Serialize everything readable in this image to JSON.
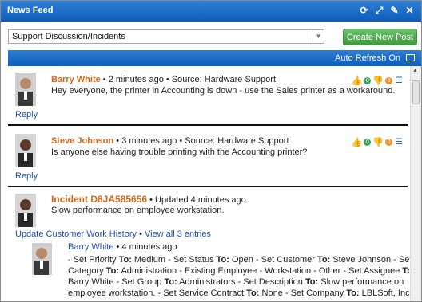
{
  "window": {
    "title": "News Feed"
  },
  "titlebar_icons": [
    "refresh-icon",
    "expand-icon",
    "wrench-icon",
    "close-icon"
  ],
  "toolbar": {
    "select_value": "Support Discussion/Incidents",
    "new_post_label": "Create New Post"
  },
  "subbar": {
    "auto_refresh": "Auto Refresh On"
  },
  "posts": [
    {
      "author": "Barry White",
      "meta": " • 2 minutes ago • Source:  Hardware Support",
      "message": "Hey everyone, the printer in Accounting is down - use the Sales printer as a workaround.",
      "reply": "Reply",
      "likes": "0",
      "dislikes": "0"
    },
    {
      "author": "Steve Johnson",
      "meta": " • 3 minutes ago • Source:  Hardware Support",
      "message": "Is anyone else having trouble printing with the Accounting printer?",
      "reply": "Reply",
      "likes": "0",
      "dislikes": "0"
    }
  ],
  "incident": {
    "title": "Incident D8JA585656",
    "meta": " • Updated 4 minutes ago",
    "message": "Slow performance on employee workstation.",
    "update_link": "Update Customer Work History",
    "separator": " • ",
    "view_all": "View all 3 entries",
    "entry_author": "Barry White",
    "entry_meta": " • 4 minutes ago",
    "entry_text_lines": [
      [
        "- Set Priority ",
        "To:",
        " Medium - Set Status ",
        "To:",
        " Open - Set Customer ",
        "To:",
        " Steve Johnson - Set"
      ],
      [
        "Category ",
        "To:",
        " Administration - Existing Employee - Workstation - Other - Set Assignee ",
        "To:"
      ],
      [
        "Barry White - Set Group ",
        "To:",
        " Administrators - Set Description ",
        "To:",
        " Slow performance on"
      ],
      [
        "employee workstation. - Set Service Contract ",
        "To:",
        " None - Set Company ",
        "To:",
        " LBLSoft, Inc."
      ]
    ]
  }
}
